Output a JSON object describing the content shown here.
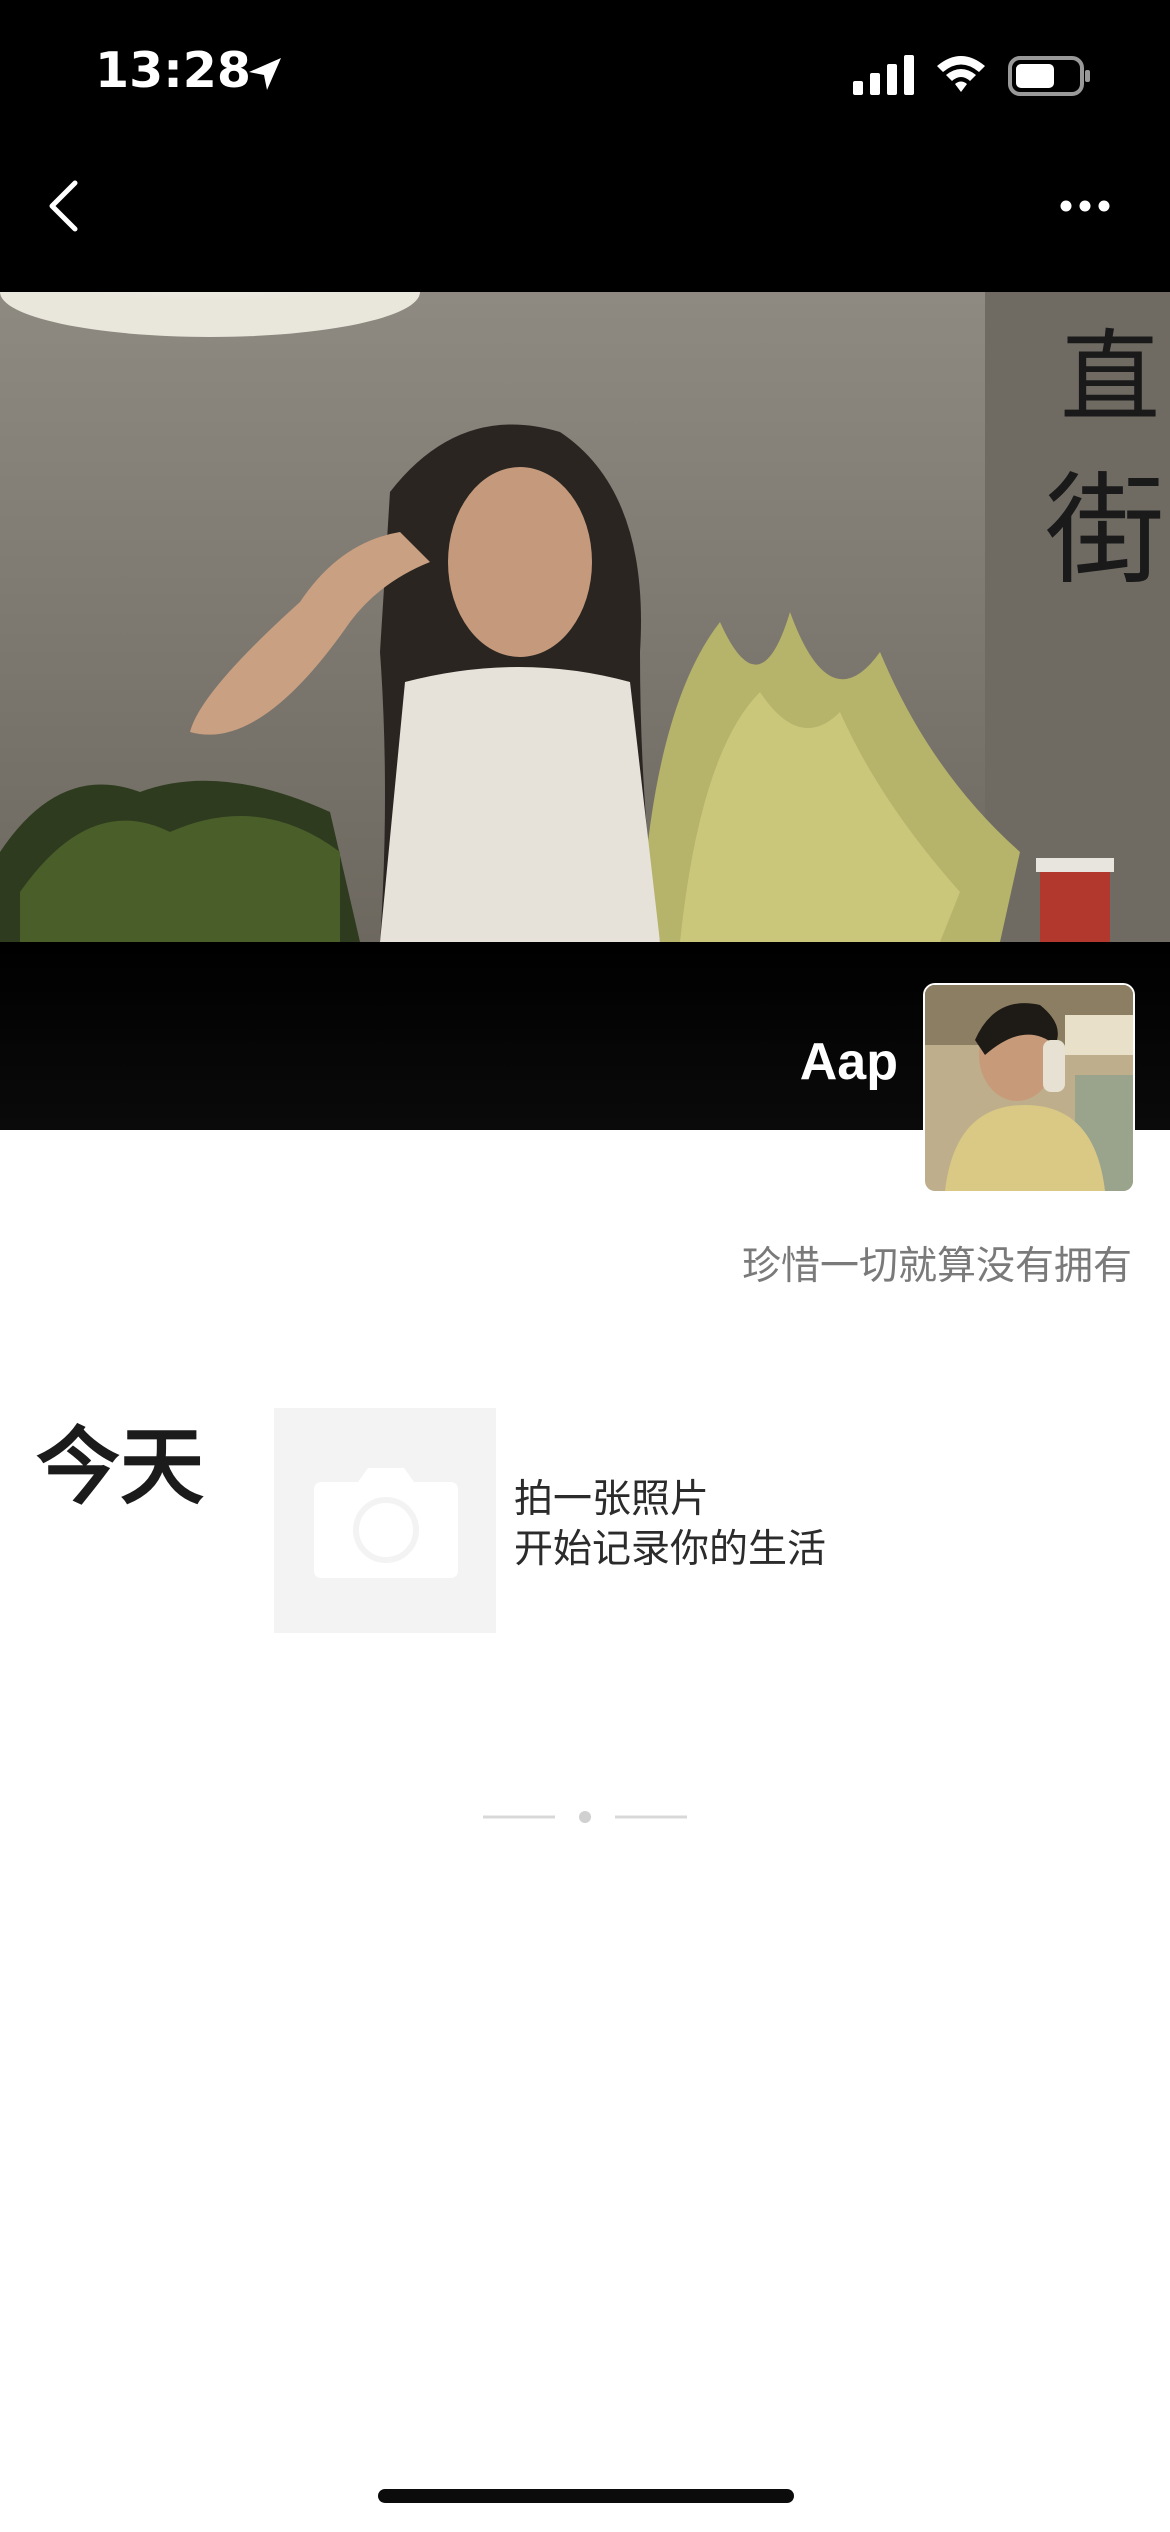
{
  "status_bar": {
    "time": "13:28",
    "icons": [
      "location-arrow-icon",
      "signal-icon",
      "wifi-icon",
      "battery-icon"
    ]
  },
  "nav": {
    "back_icon": "chevron-left-icon",
    "more_icon": "more-dots-icon"
  },
  "profile": {
    "username": "Aap",
    "signature": "珍惜一切就算没有拥有"
  },
  "timeline": {
    "section_title": "今天",
    "camera_icon": "camera-icon",
    "prompt_line1": "拍一张照片",
    "prompt_line2": "开始记录你的生活"
  },
  "colors": {
    "header_bg": "#000000",
    "page_bg": "#ffffff",
    "muted_text": "#7a7a7a",
    "tile_bg": "#f3f3f3"
  }
}
